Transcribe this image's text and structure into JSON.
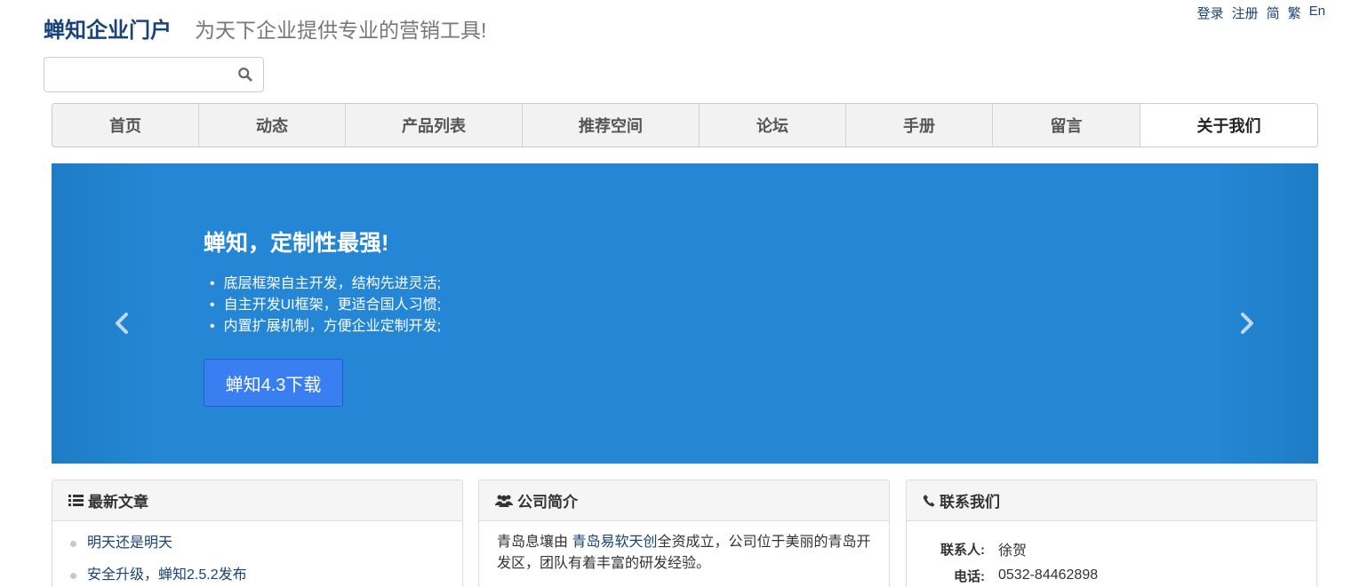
{
  "top_links": [
    "登录",
    "注册",
    "简",
    "繁",
    "En"
  ],
  "brand": {
    "name": "蝉知企业门户",
    "slogan": "为天下企业提供专业的营销工具!"
  },
  "search": {
    "placeholder": "",
    "value": ""
  },
  "nav": {
    "items": [
      "首页",
      "动态",
      "产品列表",
      "推荐空间",
      "论坛",
      "手册",
      "留言",
      "关于我们"
    ],
    "active": "关于我们"
  },
  "banner": {
    "title": "蝉知，定制性最强!",
    "bullets": [
      "底层框架自主开发，结构先进灵活;",
      "自主开发UI框架，更适合国人习惯;",
      "内置扩展机制，方便企业定制开发;"
    ],
    "button_label": "蝉知4.3下载",
    "background_color": "#2486d4"
  },
  "panels": {
    "latest": {
      "title": "最新文章",
      "items": [
        "明天还是明天",
        "安全升级，蝉知2.5.2发布"
      ]
    },
    "about": {
      "title": "公司简介",
      "text_pre": "青岛息壤由 ",
      "link": "青岛易软天创",
      "text_post": "全资成立，公司位于美丽的青岛开发区，团队有着丰富的研发经验。"
    },
    "contact": {
      "title": "联系我们",
      "rows": [
        {
          "label": "联系人:",
          "value": "徐贺"
        },
        {
          "label": "电话:",
          "value": "0532-84462898"
        }
      ]
    }
  },
  "colors": {
    "brand": "#17427a",
    "accent_button": "#3a7ff2"
  }
}
